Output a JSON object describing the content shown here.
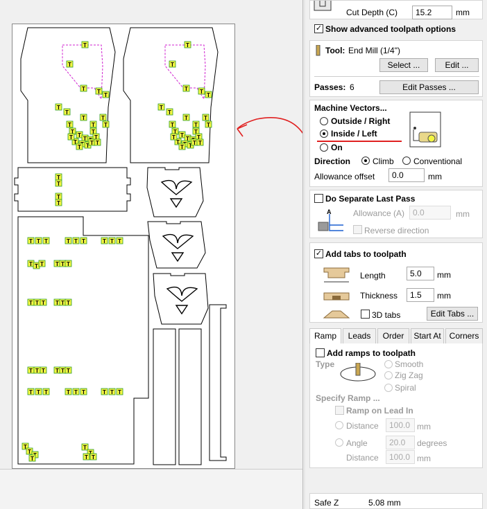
{
  "cut_depth": {
    "label": "Cut Depth (C)",
    "value": "15.2",
    "unit": "mm"
  },
  "advanced_options": {
    "label": "Show advanced toolpath options",
    "checked": true
  },
  "tool": {
    "label": "Tool:",
    "name": "End Mill (1/4\")",
    "select_label": "Select ...",
    "edit_label": "Edit ..."
  },
  "passes": {
    "label": "Passes:",
    "value": "6",
    "edit_label": "Edit Passes ..."
  },
  "machine_vectors": {
    "title": "Machine Vectors...",
    "outside_right": "Outside / Right",
    "inside_left": "Inside / Left",
    "on": "On",
    "selected": "inside_left"
  },
  "direction": {
    "label": "Direction",
    "climb": "Climb",
    "conventional": "Conventional",
    "selected": "climb"
  },
  "allowance_offset": {
    "label": "Allowance offset",
    "value": "0.0",
    "unit": "mm"
  },
  "separate_last_pass": {
    "label": "Do Separate Last Pass",
    "checked": false,
    "allowance_label": "Allowance (A)",
    "allowance_value": "0.0",
    "unit": "mm",
    "reverse_label": "Reverse direction",
    "marker": "A"
  },
  "tabs_section": {
    "label": "Add tabs to toolpath",
    "checked": true,
    "length_label": "Length",
    "length_value": "5.0",
    "thickness_label": "Thickness",
    "thickness_value": "1.5",
    "unit": "mm",
    "tabs3d_label": "3D tabs",
    "edit_tabs_label": "Edit Tabs ..."
  },
  "tab_strip": [
    "Ramp",
    "Leads",
    "Order",
    "Start At",
    "Corners"
  ],
  "ramp": {
    "add_label": "Add ramps to toolpath",
    "type_label": "Type",
    "smooth": "Smooth",
    "zigzag": "Zig Zag",
    "spiral": "Spiral",
    "specify_label": "Specify Ramp ...",
    "lead_in_label": "Ramp on Lead In",
    "distance_label": "Distance",
    "distance_value": "100.0",
    "distance_unit": "mm",
    "angle_label": "Angle",
    "angle_value": "20.0",
    "angle_unit": "degrees",
    "distance2_label": "Distance",
    "distance2_value": "100.0",
    "distance2_unit": "mm"
  },
  "safe_z": {
    "label": "Safe Z",
    "value": "5.08 mm"
  },
  "tab_marker_text": "T",
  "colors": {
    "tab_fill": "#f3f542",
    "toolpath_magenta": "#d020d0",
    "annotation_red": "#e02020",
    "accent_green": "#1aa81a"
  }
}
